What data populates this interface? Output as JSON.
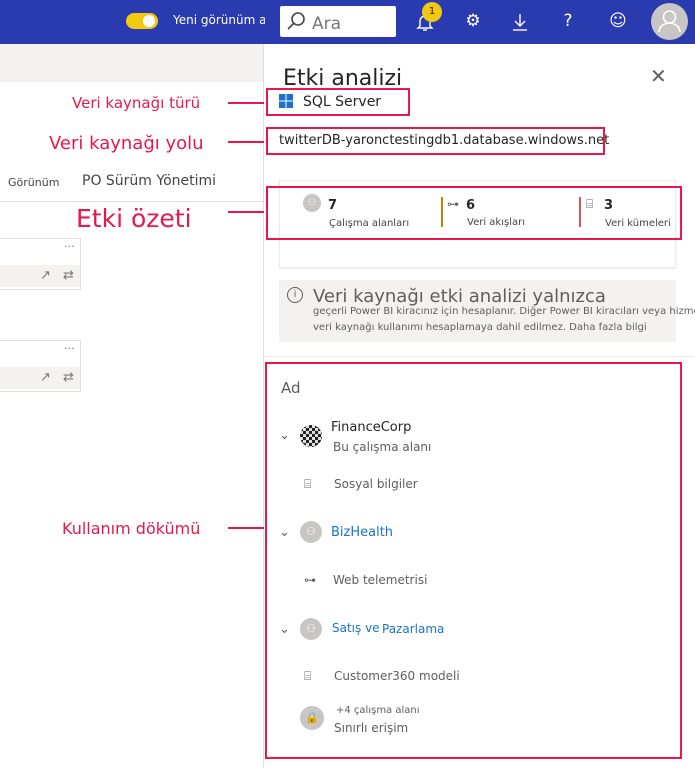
{
  "topbar": {
    "toggle_label": "Yeni görünüm aç",
    "search_placeholder": "Ara",
    "notification_count": "1",
    "icons": [
      "bell-icon",
      "gear-icon",
      "download-icon",
      "help-icon",
      "smiley-icon",
      "avatar"
    ]
  },
  "left": {
    "tab_view": "Görünüm",
    "tab_release": "PO Sürüm Yönetimi",
    "card_more": "···"
  },
  "annotations": {
    "source_type": "Veri kaynağı türü",
    "source_path": "Veri kaynağı yolu",
    "impact_summary": "Etki özeti",
    "usage_breakdown": "Kullanım dökümü"
  },
  "panel": {
    "title": "Etki analizi",
    "source_type": "SQL Server",
    "source_path": "twitterDB-yaronctestingdb1.database.windows.net",
    "stats": [
      {
        "value": "7",
        "label": "Çalışma alanları"
      },
      {
        "value": "6",
        "label": "Veri akışları"
      },
      {
        "value": "3",
        "label": "Veri kümeleri"
      }
    ],
    "info_title": "Veri kaynağı etki analizi yalnızca",
    "info_line1": "geçerli Power BI kiracınız için hesaplanır. Diğer Power BI kiracıları veya hizmetler",
    "info_line2": "veri kaynağı kullanımı hesaplamaya dahil edilmez. Daha fazla bilgi",
    "column_header": "Ad",
    "workspaces": [
      {
        "name": "FinanceCorp",
        "sub": "Bu çalışma alanı",
        "item": "Sosyal bilgiler"
      },
      {
        "name": "BizHealth",
        "item": "Web telemetrisi"
      },
      {
        "name": "Satış ve",
        "name2": "Pazarlama",
        "item": "Customer360 modeli"
      }
    ],
    "more_workspaces": "+4 çalışma alanı",
    "limited_access": "Sınırlı erişim"
  },
  "colors": {
    "accent": "#2a3bb0",
    "annotation": "#e8184c",
    "toggle": "#f2c811",
    "link": "#1a73c8"
  }
}
